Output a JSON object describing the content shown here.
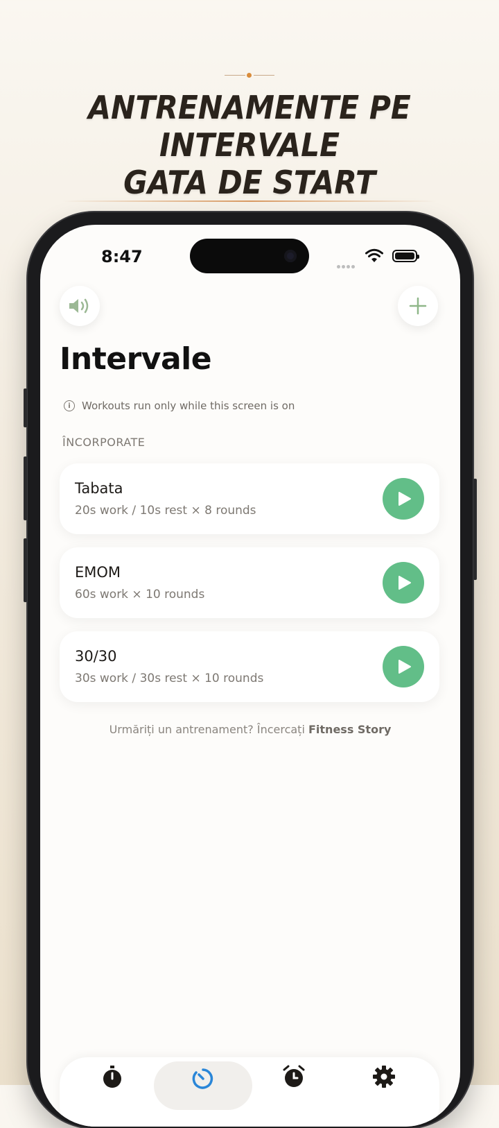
{
  "promo": {
    "headline_line1": "ANTRENAMENTE PE INTERVALE",
    "headline_line2": "GATA DE START"
  },
  "status_bar": {
    "time": "8:47"
  },
  "header": {
    "sound_icon": "speaker-icon",
    "add_icon": "plus-icon",
    "title": "Intervale"
  },
  "notice": {
    "text": "Workouts run only while this screen is on"
  },
  "section_label": "ÎNCORPORATE",
  "workouts": [
    {
      "name": "Tabata",
      "description": "20s work / 10s rest × 8 rounds"
    },
    {
      "name": "EMOM",
      "description": "60s work × 10 rounds"
    },
    {
      "name": "30/30",
      "description": "30s work / 30s rest × 10 rounds"
    }
  ],
  "footer": {
    "prefix": "Urmăriți un antrenament? Încercați",
    "link": "Fitness Story"
  },
  "tabs": [
    {
      "icon": "stopwatch-icon",
      "active": false
    },
    {
      "icon": "interval-timer-icon",
      "active": true
    },
    {
      "icon": "alarm-clock-icon",
      "active": false
    },
    {
      "icon": "gear-icon",
      "active": false
    }
  ],
  "colors": {
    "accent_green": "#62be88",
    "active_tab_blue": "#2a86d8",
    "headline": "#2a231c"
  }
}
